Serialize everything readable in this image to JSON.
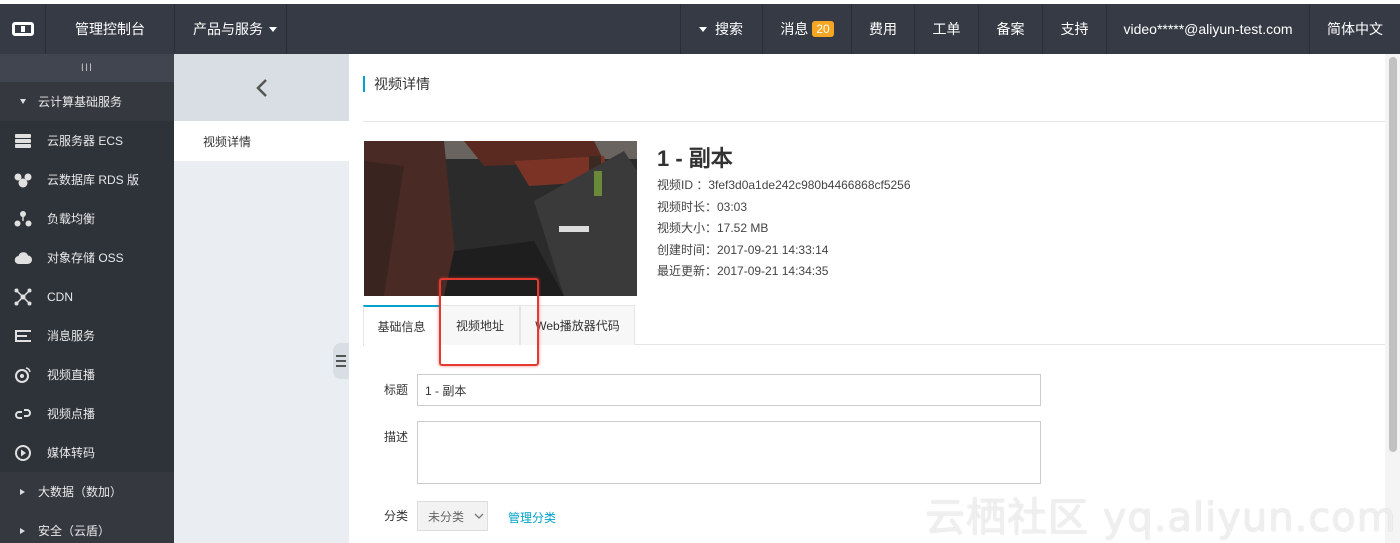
{
  "topbar": {
    "console": "管理控制台",
    "products": "产品与服务",
    "search": "搜索",
    "messages": "消息",
    "messages_count": "20",
    "billing": "费用",
    "tickets": "工单",
    "icp": "备案",
    "support": "支持",
    "account": "video*****@aliyun-test.com",
    "language": "简体中文"
  },
  "sidebar": {
    "handle": "III",
    "group_cloud": "云计算基础服务",
    "items": [
      {
        "label": "云服务器 ECS",
        "icon": "server-icon"
      },
      {
        "label": "云数据库 RDS 版",
        "icon": "database-icon"
      },
      {
        "label": "负载均衡",
        "icon": "load-balancer-icon"
      },
      {
        "label": "对象存储 OSS",
        "icon": "cloud-storage-icon"
      },
      {
        "label": "CDN",
        "icon": "cdn-icon"
      },
      {
        "label": "消息服务",
        "icon": "message-service-icon"
      },
      {
        "label": "视频直播",
        "icon": "live-video-icon"
      },
      {
        "label": "视频点播",
        "icon": "vod-icon"
      },
      {
        "label": "媒体转码",
        "icon": "transcode-icon"
      }
    ],
    "group_bigdata": "大数据（数加）",
    "group_security": "安全（云盾）"
  },
  "subnav": {
    "item": "视频详情"
  },
  "main": {
    "page_title": "视频详情",
    "video_title": "1 - 副本",
    "meta": {
      "id": "视频ID  ：3fef3d0a1de242c980b4466868cf5256",
      "duration": "视频时长：03:03",
      "size": "视频大小：17.52 MB",
      "created": "创建时间：2017-09-21 14:33:14",
      "updated": "最近更新：2017-09-21 14:34:35"
    },
    "tabs": [
      "基础信息",
      "视频地址",
      "Web播放器代码"
    ],
    "form": {
      "title_label": "标题",
      "title_value": "1 - 副本",
      "desc_label": "描述",
      "desc_value": "",
      "category_label": "分类",
      "category_value": "未分类",
      "manage_category": "管理分类"
    }
  },
  "watermark": "云栖社区 yq.aliyun.com",
  "colors": {
    "topbar": "#363a44",
    "sidebar": "#2e3239",
    "accent": "#00a2ca",
    "badge": "#f5a623",
    "highlight": "#e53a2f"
  }
}
